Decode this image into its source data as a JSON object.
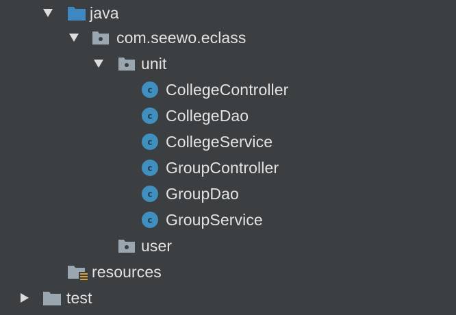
{
  "tree": {
    "java": {
      "label": "java",
      "icon": "source-folder-icon",
      "expanded": true
    },
    "package": {
      "label": "com.seewo.eclass",
      "icon": "package-icon",
      "expanded": true
    },
    "unit": {
      "label": "unit",
      "icon": "package-icon",
      "expanded": true
    },
    "classes": [
      {
        "label": "CollegeController",
        "icon": "class-icon"
      },
      {
        "label": "CollegeDao",
        "icon": "class-icon"
      },
      {
        "label": "CollegeService",
        "icon": "class-icon"
      },
      {
        "label": "GroupController",
        "icon": "class-icon"
      },
      {
        "label": "GroupDao",
        "icon": "class-icon"
      },
      {
        "label": "GroupService",
        "icon": "class-icon"
      }
    ],
    "user": {
      "label": "user",
      "icon": "package-icon"
    },
    "resources": {
      "label": "resources",
      "icon": "resources-folder-icon"
    },
    "test": {
      "label": "test",
      "icon": "folder-icon",
      "expanded": false
    }
  },
  "colors": {
    "background": "#3c3f41",
    "text": "#e3e3e3",
    "arrow": "#dcdcdc",
    "source_folder": "#3d88c0",
    "folder": "#9aa7b0",
    "class_icon": "#3f8fbf"
  }
}
